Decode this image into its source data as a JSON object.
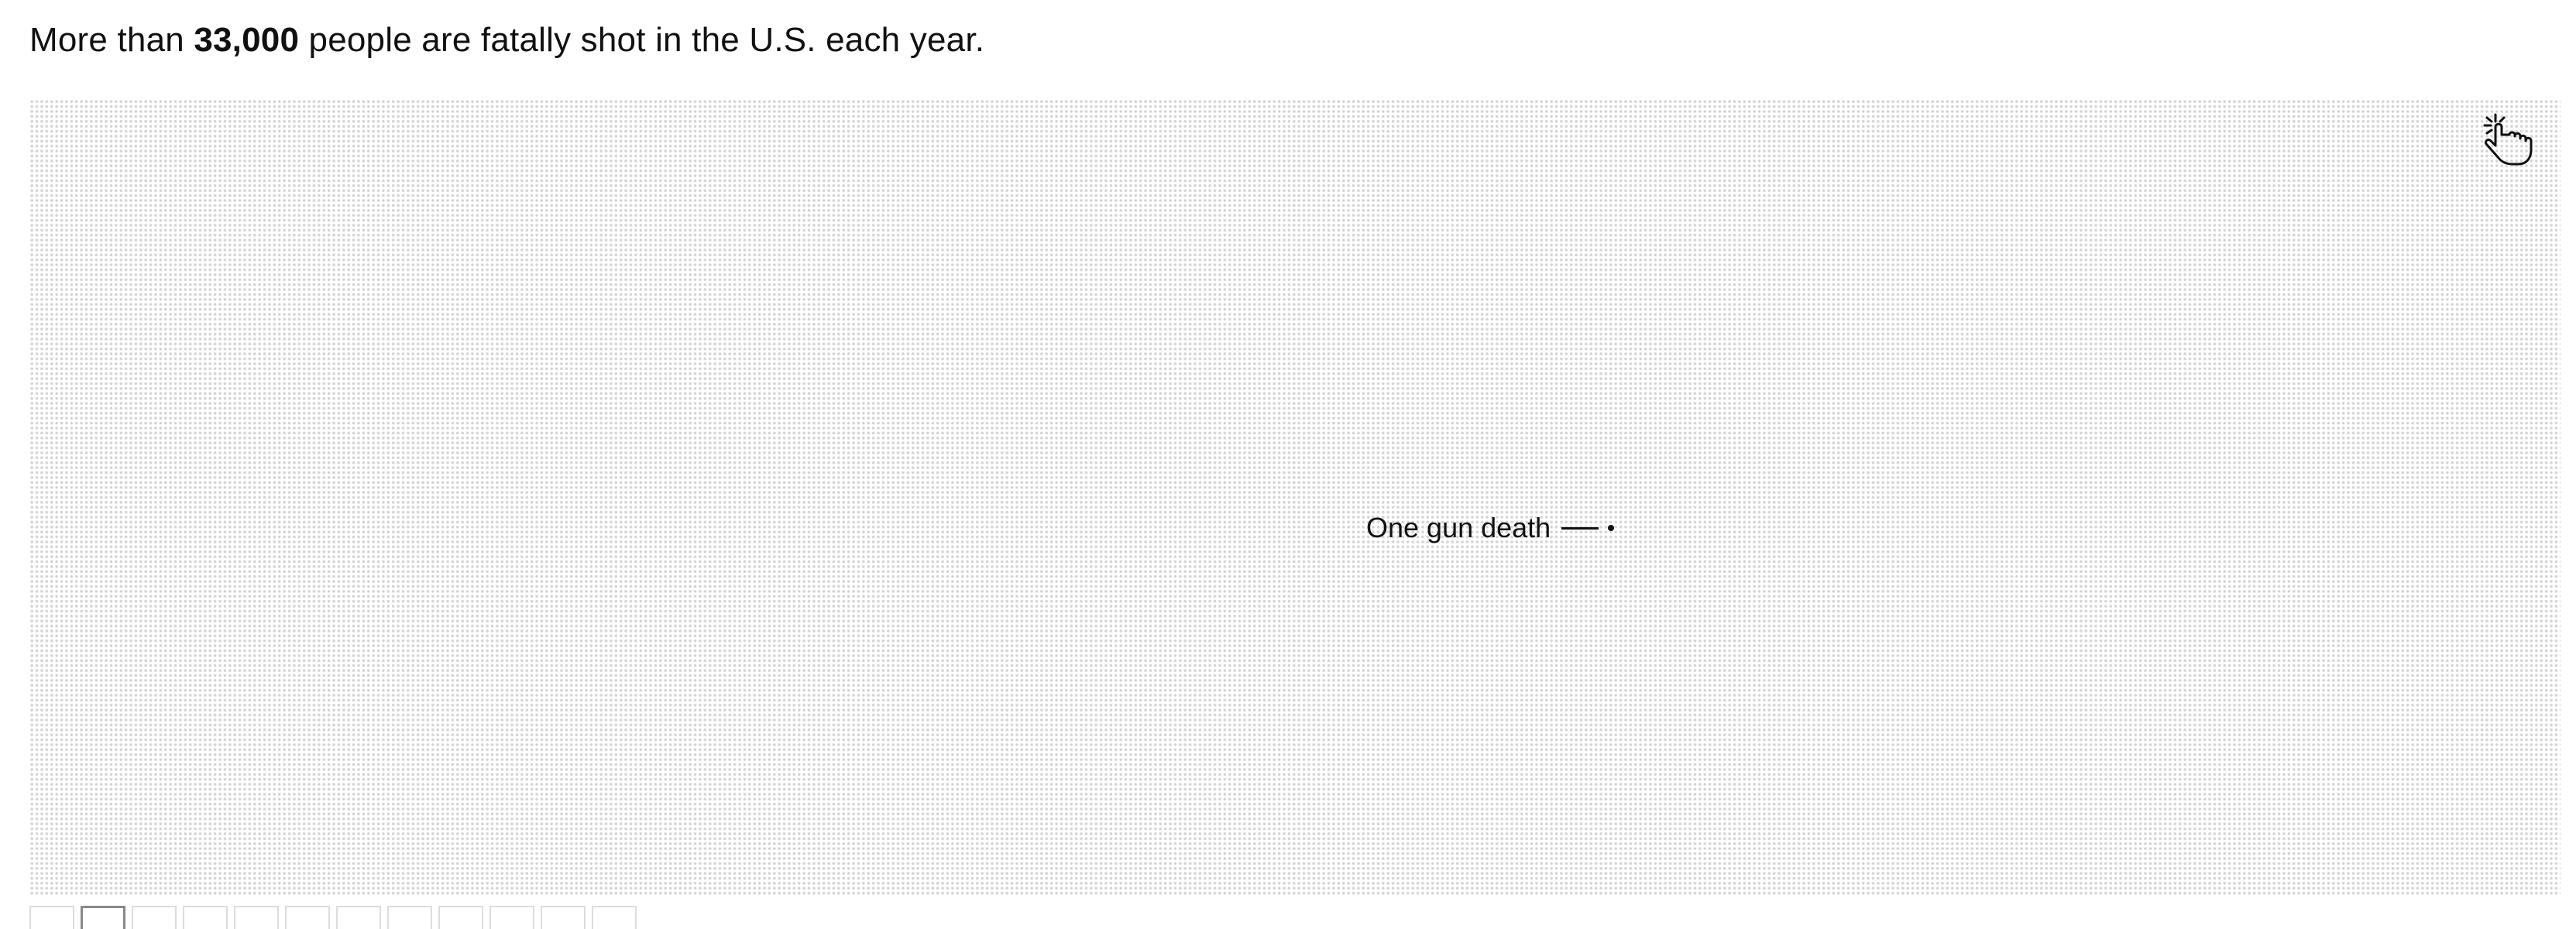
{
  "headline": {
    "prefix": "More than ",
    "number": "33,000",
    "suffix": " people are fatally shot in the U.S. each year."
  },
  "annotation": {
    "label": "One gun death"
  },
  "tap_icon": "tap-hand-icon",
  "slides": {
    "count": 12,
    "active_index": 1
  },
  "colors": {
    "dot": "#d4d4d4",
    "text": "#111111",
    "highlight_dot": "#111111"
  }
}
